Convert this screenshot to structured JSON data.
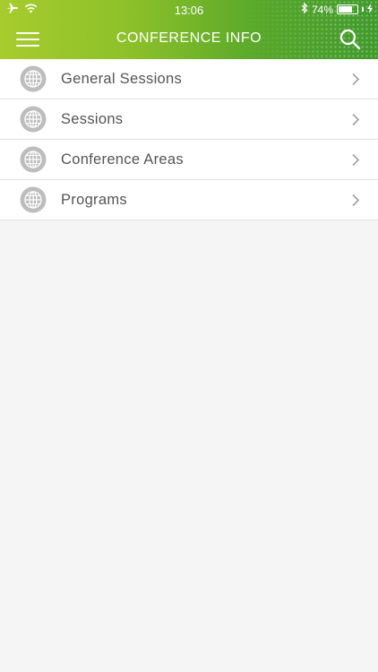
{
  "status_bar": {
    "time": "13:06",
    "battery": "74%",
    "battery_level": 0.74
  },
  "header": {
    "title": "CONFERENCE INFO",
    "menu_icon": "hamburger-menu-icon",
    "search_icon": "search-icon"
  },
  "colors": {
    "header_gradient_start": "#a7cc2c",
    "header_gradient_end": "#3f9a2c",
    "icon_gray": "#b8b8b8",
    "text_gray": "#555555",
    "background": "#f5f5f5"
  },
  "list": {
    "items": [
      {
        "label": "General Sessions",
        "icon": "globe-icon"
      },
      {
        "label": "Sessions",
        "icon": "globe-icon"
      },
      {
        "label": "Conference Areas",
        "icon": "globe-icon"
      },
      {
        "label": "Programs",
        "icon": "globe-icon"
      }
    ]
  }
}
